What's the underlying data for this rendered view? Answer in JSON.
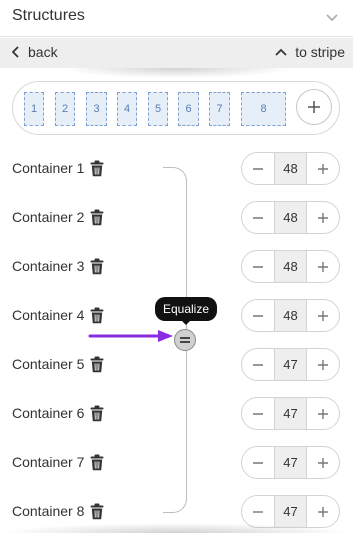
{
  "header": {
    "title": "Structures"
  },
  "subnav": {
    "back_label": "back",
    "stripe_label": "to stripe"
  },
  "preview": {
    "cells": [
      {
        "label": "1"
      },
      {
        "label": "2"
      },
      {
        "label": "3"
      },
      {
        "label": "4"
      },
      {
        "label": "5"
      },
      {
        "label": "6"
      },
      {
        "label": "7"
      },
      {
        "label": "8"
      }
    ]
  },
  "containers": [
    {
      "label": "Container 1",
      "value": "48"
    },
    {
      "label": "Container 2",
      "value": "48"
    },
    {
      "label": "Container 3",
      "value": "48"
    },
    {
      "label": "Container 4",
      "value": "48"
    },
    {
      "label": "Container 5",
      "value": "47"
    },
    {
      "label": "Container 6",
      "value": "47"
    },
    {
      "label": "Container 7",
      "value": "47"
    },
    {
      "label": "Container 8",
      "value": "47"
    }
  ],
  "tooltip": {
    "text": "Equalize"
  },
  "colors": {
    "cell_fill": "#e6eef8",
    "cell_border": "#7f9fd0",
    "arrow": "#8a2be2"
  },
  "icons": {
    "collapse": "chevron-down-icon",
    "back": "chevron-left-icon",
    "stripe": "chevron-up-icon",
    "add": "plus-icon",
    "delete": "trash-icon",
    "equalize": "equals-icon",
    "minus": "minus-icon",
    "plus": "plus-icon"
  }
}
